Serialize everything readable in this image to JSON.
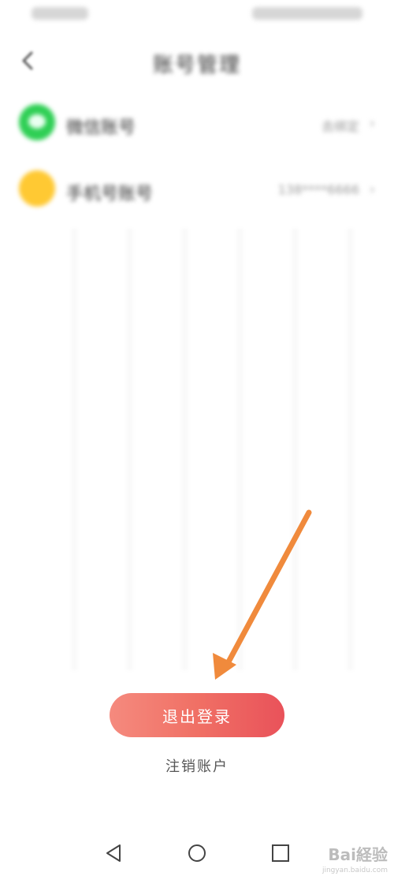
{
  "header": {
    "title": "账号管理"
  },
  "accounts": [
    {
      "label": "微信账号",
      "value": "去绑定",
      "icon": "wechat-icon",
      "color": "#2fcf55"
    },
    {
      "label": "手机号账号",
      "value": "138****6666",
      "icon": "phone-icon",
      "color": "#ffc933"
    }
  ],
  "actions": {
    "logout_label": "退出登录",
    "cancel_account_label": "注销账户"
  },
  "annotation": {
    "arrow_color": "#f08a3c"
  },
  "nav": {
    "back_icon": "triangle-back-icon",
    "home_icon": "circle-home-icon",
    "recent_icon": "square-recent-icon"
  },
  "watermark": {
    "brand": "Bai経验",
    "site": "jingyan.baidu.com"
  },
  "colors": {
    "accent_start": "#f58a7e",
    "accent_end": "#e9525a"
  }
}
